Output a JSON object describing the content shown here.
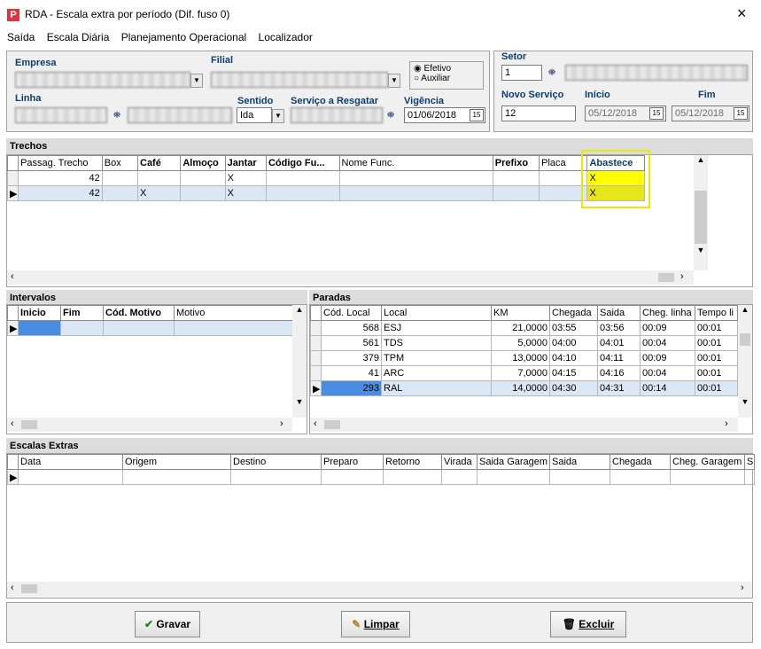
{
  "window": {
    "title": "RDA - Escala extra por período (Dif. fuso 0)",
    "close": "×",
    "icon": "P"
  },
  "menu": [
    "Saída",
    "Escala Diária",
    "Planejamento Operacional",
    "Localizador"
  ],
  "form": {
    "empresa_label": "Empresa",
    "filial_label": "Filial",
    "linha_label": "Linha",
    "sentido_label": "Sentido",
    "sentido_value": "Ida",
    "servico_label": "Serviço a Resgatar",
    "vigencia_label": "Vigência",
    "vigencia_value": "01/06/2018",
    "radio_efetivo": "Efetivo",
    "radio_auxiliar": "Auxiliar",
    "setor_label": "Setor",
    "setor_value": "1",
    "novo_servico_label": "Novo Serviço",
    "novo_servico_value": "12",
    "inicio_label": "Início",
    "inicio_value": "05/12/2018",
    "fim_label": "Fim",
    "fim_value": "05/12/2018",
    "cal_glyph": "15"
  },
  "trechos": {
    "title": "Trechos",
    "columns": [
      "Passag. Trecho",
      "Box",
      "Café",
      "Almoço",
      "Jantar",
      "Código Fu...",
      "Nome Func.",
      "Prefixo",
      "Placa",
      "Abastece"
    ],
    "rows": [
      [
        "42",
        "",
        "",
        "",
        "X",
        "",
        "",
        "",
        "",
        "X"
      ],
      [
        "42",
        "",
        "X",
        "",
        "X",
        "",
        "",
        "",
        "",
        "X"
      ]
    ]
  },
  "intervalos": {
    "title": "Intervalos",
    "columns": [
      "Inicio",
      "Fim",
      "Cód. Motivo",
      "Motivo"
    ]
  },
  "paradas": {
    "title": "Paradas",
    "columns": [
      "Cód. Local",
      "Local",
      "KM",
      "Chegada",
      "Saida",
      "Cheg. linha",
      "Tempo li"
    ],
    "rows": [
      [
        "568",
        "ESJ",
        "21,0000",
        "03:55",
        "03:56",
        "00:09",
        "00:01"
      ],
      [
        "561",
        "TDS",
        "5,0000",
        "04:00",
        "04:01",
        "00:04",
        "00:01"
      ],
      [
        "379",
        "TPM",
        "13,0000",
        "04:10",
        "04:11",
        "00:09",
        "00:01"
      ],
      [
        "41",
        "ARC",
        "7,0000",
        "04:15",
        "04:16",
        "00:04",
        "00:01"
      ],
      [
        "293",
        "RAL",
        "14,0000",
        "04:30",
        "04:31",
        "00:14",
        "00:01"
      ]
    ]
  },
  "escalas": {
    "title": "Escalas Extras",
    "columns": [
      "Data",
      "Origem",
      "Destino",
      "Preparo",
      "Retorno",
      "Virada",
      "Saida Garagem",
      "Saida",
      "Chegada",
      "Cheg. Garagem",
      "S"
    ]
  },
  "buttons": {
    "gravar": "Gravar",
    "limpar": "Limpar",
    "excluir": "Excluir"
  },
  "colors": {
    "highlight": "#ffff00",
    "label": "#0c3d6e",
    "selected_row": "#dce7f5"
  }
}
